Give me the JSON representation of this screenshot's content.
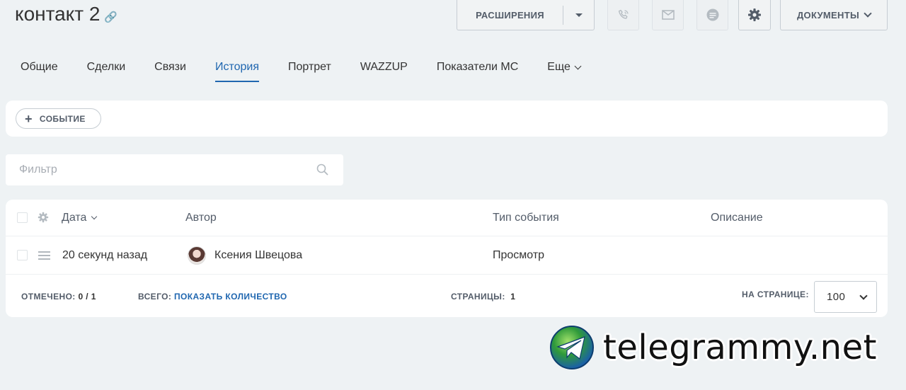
{
  "header": {
    "title": "контакт 2",
    "extensions_label": "РАСШИРЕНИЯ",
    "documents_label": "ДОКУМЕНТЫ"
  },
  "tabs": [
    {
      "label": "Общие"
    },
    {
      "label": "Сделки"
    },
    {
      "label": "Связи"
    },
    {
      "label": "История",
      "active": true
    },
    {
      "label": "Портрет"
    },
    {
      "label": "WAZZUP"
    },
    {
      "label": "Показатели МС"
    },
    {
      "label": "Еще"
    }
  ],
  "event_button": {
    "label": "СОБЫТИЕ"
  },
  "filter": {
    "placeholder": "Фильтр"
  },
  "grid": {
    "columns": [
      "Дата",
      "Автор",
      "Тип события",
      "Описание"
    ],
    "rows": [
      {
        "date": "20 секунд назад",
        "author": "Ксения Швецова",
        "type": "Просмотр",
        "description": ""
      }
    ],
    "footer": {
      "marked_label": "ОТМЕЧЕНО:",
      "marked_value": "0 / 1",
      "total_label": "ВСЕГО:",
      "total_link": "ПОКАЗАТЬ КОЛИЧЕСТВО",
      "pages_label": "СТРАНИЦЫ:",
      "pages_value": "1",
      "per_page_label": "НА СТРАНИЦЕ:",
      "per_page_value": "100"
    }
  },
  "watermark": {
    "text": "telegrammy.net"
  },
  "colors": {
    "accent": "#2067b0",
    "background": "#eef2f4",
    "panel": "#ffffff"
  }
}
